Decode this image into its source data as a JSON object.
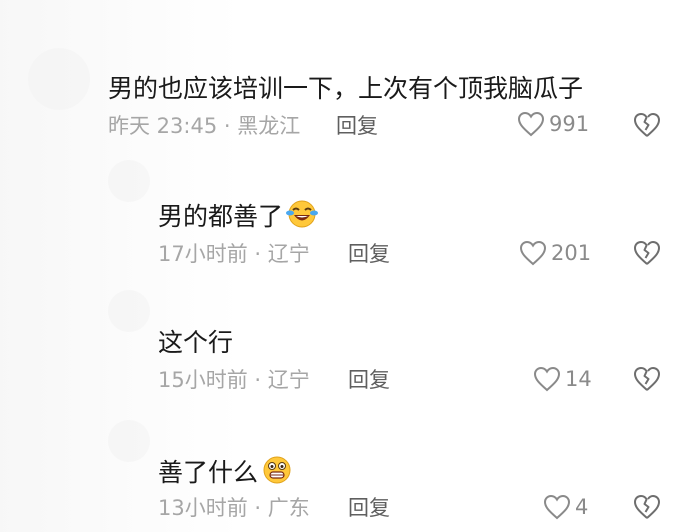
{
  "comments": [
    {
      "text": "男的也应该培训一下，上次有个顶我脑瓜子",
      "time": "昨天 23:45",
      "location": "黑龙江",
      "reply": "回复",
      "likes": "991"
    },
    {
      "text": "男的都善了",
      "emoji": "rolling-laughing-emoji",
      "time": "17小时前",
      "location": "辽宁",
      "reply": "回复",
      "likes": "201"
    },
    {
      "text": "这个行",
      "time": "15小时前",
      "location": "辽宁",
      "reply": "回复",
      "likes": "14"
    },
    {
      "text": "善了什么",
      "emoji": "grinning-emoji",
      "time": "13小时前",
      "location": "广东",
      "reply": "回复",
      "likes": "4"
    }
  ],
  "separator": "·",
  "icons": {
    "like": "heart-outline-icon",
    "dislike": "broken-heart-icon"
  },
  "colors": {
    "text": "#1a1a1a",
    "meta": "#a6a6a6",
    "reply": "#5f5f5f"
  }
}
